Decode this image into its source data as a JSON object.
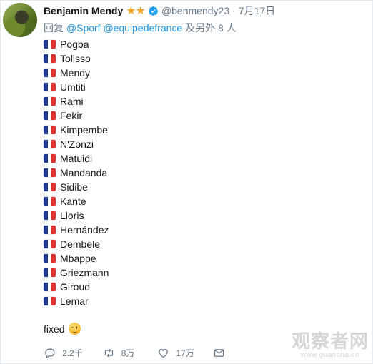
{
  "tweet": {
    "author_name": "Benjamin Mendy",
    "author_stars": "★★",
    "handle": "@benmendy23",
    "separator": "·",
    "date": "7月17日",
    "reply_prefix": "回复",
    "reply_mentions": [
      "@Sporf",
      "@equipedefrance"
    ],
    "reply_suffix": "及另外 8 人",
    "players": [
      "Pogba",
      "Tolisso",
      "Mendy",
      "Umtiti",
      "Rami",
      "Fekir",
      "Kimpembe",
      "N'Zonzi",
      "Matuidi",
      "Mandanda",
      "Sidibe",
      "Kante",
      "Lloris",
      "Hernández",
      "Dembele",
      "Mbappe",
      "Griezmann",
      "Giroud",
      "Lemar"
    ],
    "closing_text": "fixed",
    "closing_emoji": "winking-face-emoji",
    "flag_emoji": "french-flag-emoji"
  },
  "actions": {
    "reply_count": "2.2千",
    "retweet_count": "8万",
    "like_count": "17万"
  },
  "watermark": {
    "title": "观察者网",
    "url": "www.guancha.cn"
  },
  "colors": {
    "link": "#1b95e0",
    "secondary_text": "#657786",
    "verified": "#1da1f2",
    "star": "#f5a623",
    "flag_blue": "#1f3a93",
    "flag_red": "#e0312f"
  }
}
